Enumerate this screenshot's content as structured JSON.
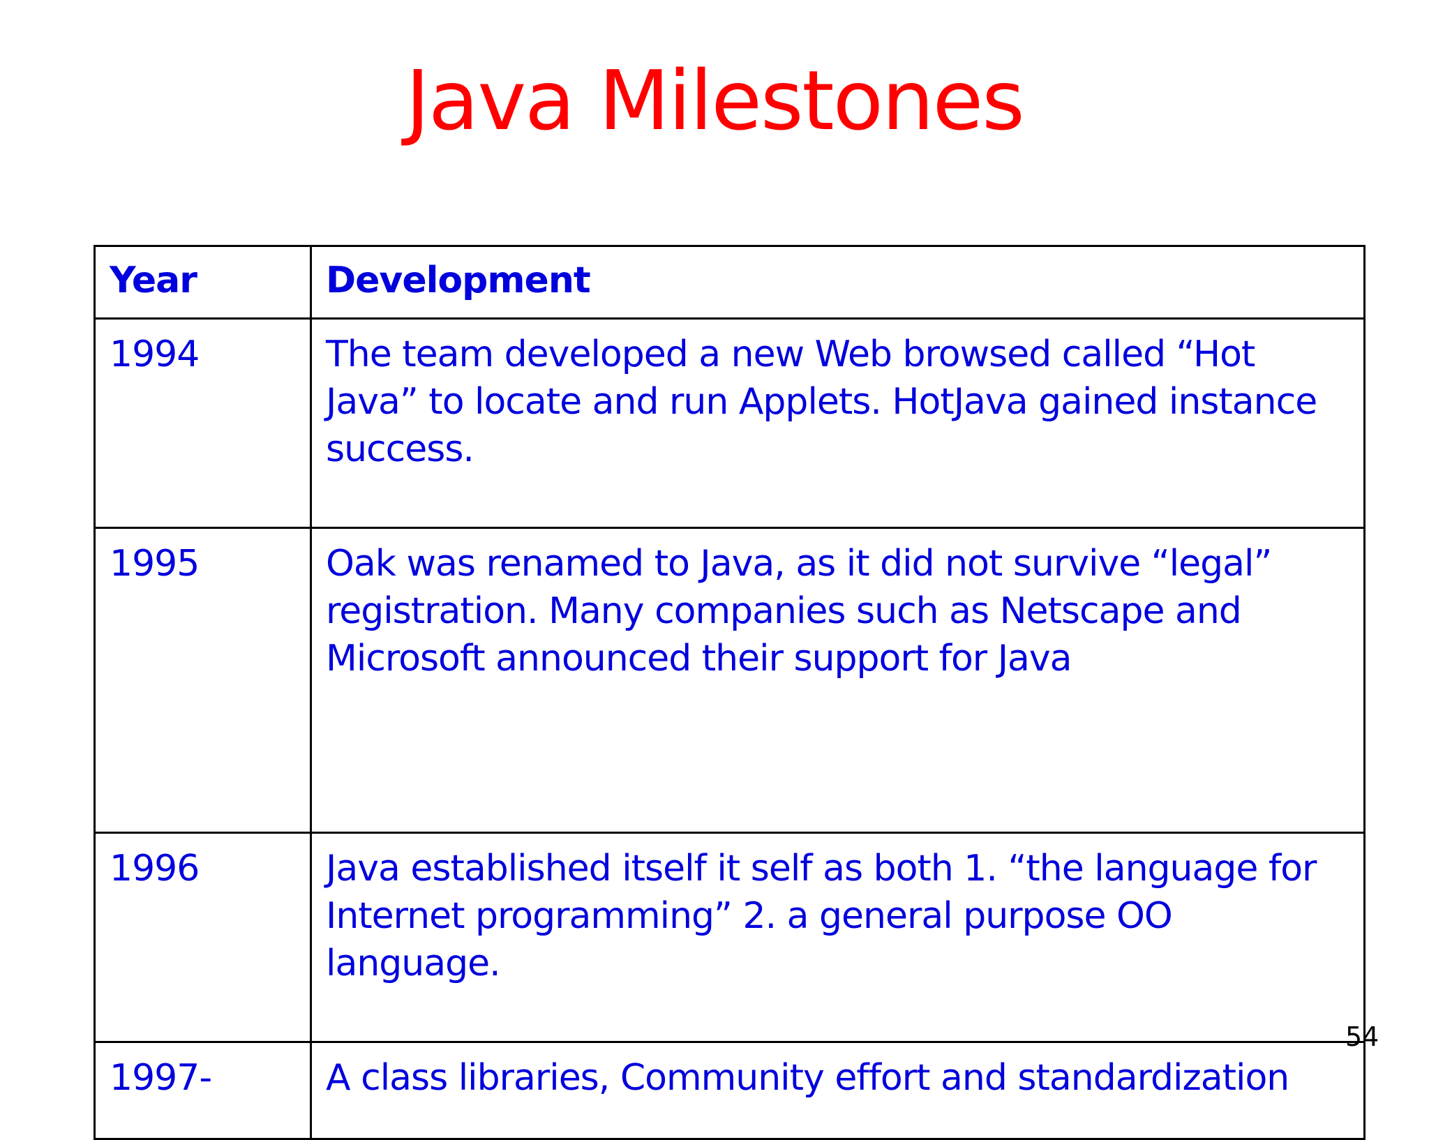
{
  "slide": {
    "title": "Java Milestones",
    "page_number": "54"
  },
  "table": {
    "headers": {
      "year": "Year",
      "development": "Development"
    },
    "rows": [
      {
        "year": "1994",
        "development": "The team developed a new Web browsed called “Hot Java” to locate and run Applets. HotJava gained instance success."
      },
      {
        "year": "1995",
        "development": "Oak was renamed to Java, as it did not survive “legal” registration. Many companies such as Netscape and Microsoft announced their support for Java"
      },
      {
        "year": "1996",
        "development": "Java established itself it self as both 1. “the language for Internet programming” 2. a general purpose OO language."
      },
      {
        "year": "1997-",
        "development": "A class libraries, Community effort and standardization"
      }
    ]
  },
  "colors": {
    "title": "#ff0000",
    "table_text": "#0000dd",
    "border": "#000000",
    "background": "#ffffff"
  }
}
